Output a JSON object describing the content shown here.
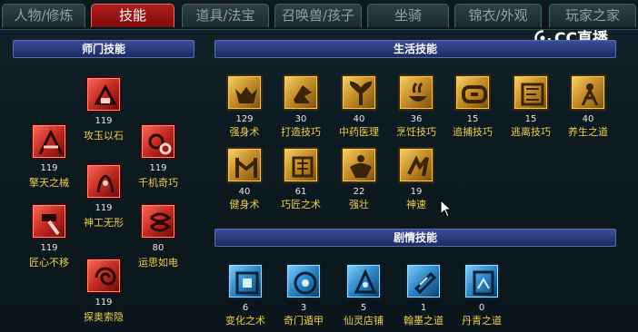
{
  "tabs": [
    {
      "label": "人物/修炼"
    },
    {
      "label": "技能"
    },
    {
      "label": "道具/法宝"
    },
    {
      "label": "召唤兽/孩子"
    },
    {
      "label": "坐骑"
    },
    {
      "label": "锦衣/外观"
    },
    {
      "label": "玩家之家"
    }
  ],
  "active_tab": "技能",
  "watermark": "CC直播",
  "sections": {
    "master": {
      "title": "师门技能",
      "skills": [
        {
          "name": "攻玉以石",
          "level": "119",
          "icon": "jade-tool-icon"
        },
        {
          "name": "擎天之械",
          "level": "119",
          "icon": "mechanism-icon"
        },
        {
          "name": "千机奇巧",
          "level": "119",
          "icon": "gears-icon"
        },
        {
          "name": "神工无形",
          "level": "119",
          "icon": "hand-craft-icon"
        },
        {
          "name": "匠心不移",
          "level": "119",
          "icon": "hammer-icon"
        },
        {
          "name": "运思如电",
          "level": "80",
          "icon": "spiral-scroll-icon"
        },
        {
          "name": "探奥索隐",
          "level": "119",
          "icon": "vortex-icon"
        }
      ]
    },
    "life": {
      "title": "生活技能",
      "skills": [
        {
          "name": "强身术",
          "level": "129",
          "icon": "strength-icon"
        },
        {
          "name": "打造技巧",
          "level": "30",
          "icon": "forging-icon"
        },
        {
          "name": "中药医理",
          "level": "40",
          "icon": "herb-icon"
        },
        {
          "name": "烹饪技巧",
          "level": "36",
          "icon": "cooking-icon"
        },
        {
          "name": "追捕技巧",
          "level": "15",
          "icon": "pursuit-icon"
        },
        {
          "name": "逃离技巧",
          "level": "15",
          "icon": "escape-icon"
        },
        {
          "name": "养生之道",
          "level": "40",
          "icon": "health-icon"
        },
        {
          "name": "健身术",
          "level": "40",
          "icon": "fitness-icon"
        },
        {
          "name": "巧匠之术",
          "level": "61",
          "icon": "craftsman-icon"
        },
        {
          "name": "强壮",
          "level": "22",
          "icon": "muscle-icon"
        },
        {
          "name": "神速",
          "level": "19",
          "icon": "speed-icon"
        }
      ]
    },
    "story": {
      "title": "剧情技能",
      "skills": [
        {
          "name": "变化之术",
          "level": "6",
          "icon": "transform-icon"
        },
        {
          "name": "奇门遁甲",
          "level": "3",
          "icon": "qimen-icon"
        },
        {
          "name": "仙灵店铺",
          "level": "5",
          "icon": "shop-icon"
        },
        {
          "name": "翰墨之道",
          "level": "1",
          "icon": "ink-icon"
        },
        {
          "name": "丹青之道",
          "level": "0",
          "icon": "painting-icon"
        }
      ]
    }
  },
  "colors": {
    "active_tab": "#b11c1c",
    "skill_name": "#f0cf4a",
    "level_text": "#e8e8e8",
    "section_header": "#2b3b7e"
  }
}
